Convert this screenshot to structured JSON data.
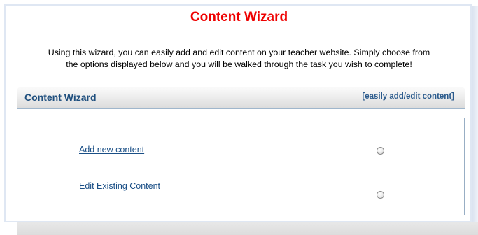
{
  "page": {
    "title": "Content Wizard",
    "intro_line1": "Using this wizard, you can easily add and edit content on your teacher website. Simply choose from",
    "intro_line2": "the options displayed below and you will be walked through the task you wish to complete!"
  },
  "section": {
    "title": "Content Wizard",
    "subtitle": "[easily add/edit content]"
  },
  "options": [
    {
      "label": "Add new content",
      "selected": false
    },
    {
      "label": "Edit Existing Content",
      "selected": false
    }
  ],
  "colors": {
    "title": "#ee0000",
    "link": "#1a4f86",
    "section_title": "#1f4f7e",
    "border": "#98aec4"
  }
}
